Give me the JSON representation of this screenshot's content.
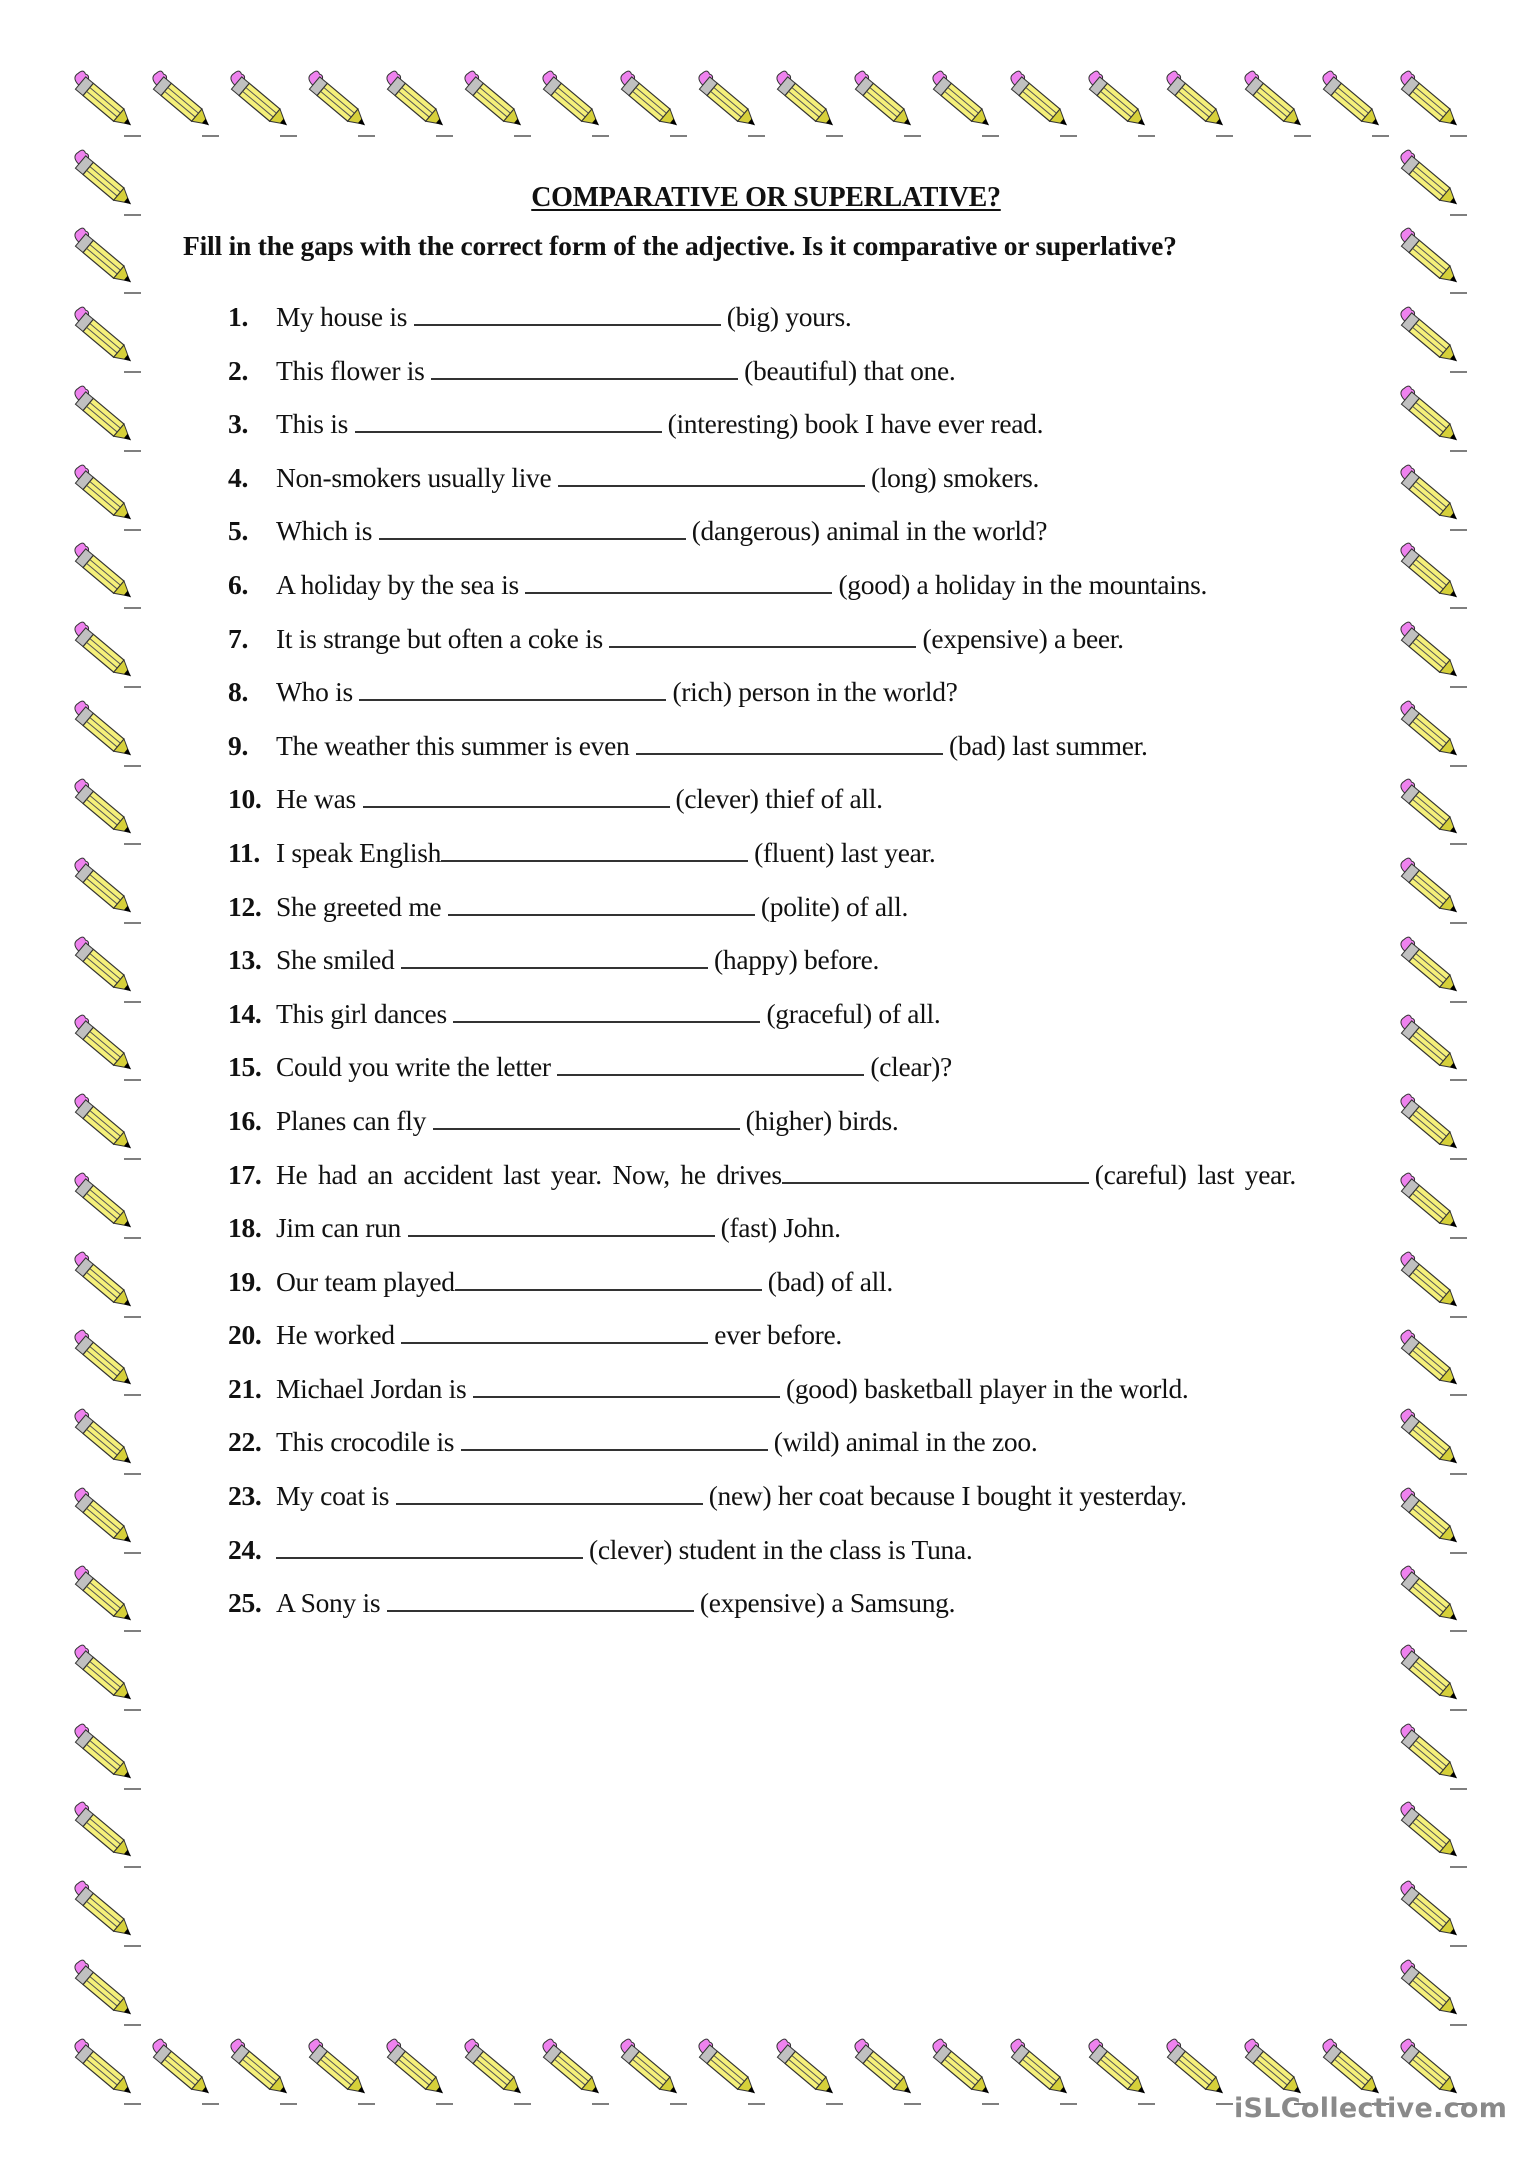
{
  "worksheet": {
    "title": "COMPARATIVE OR SUPERLATIVE?",
    "instruction": "Fill in the gaps with the correct form of the adjective. Is it comparative or superlative?",
    "items": [
      {
        "number": "1.",
        "before": "My house is",
        "after": "(big) yours."
      },
      {
        "number": "2.",
        "before": "This flower is",
        "after": "(beautiful) that one."
      },
      {
        "number": "3.",
        "before": "This is",
        "after": "(interesting) book I have ever read."
      },
      {
        "number": "4.",
        "before": "Non-smokers usually live",
        "after": "(long) smokers."
      },
      {
        "number": "5.",
        "before": "Which is",
        "after": "(dangerous) animal in the world?"
      },
      {
        "number": "6.",
        "before": "A holiday by the sea is",
        "after": "(good) a holiday in the mountains."
      },
      {
        "number": "7.",
        "before": "It is strange but often a coke is",
        "after": "(expensive) a beer."
      },
      {
        "number": "8.",
        "before": "Who is",
        "after": "(rich) person in the world?"
      },
      {
        "number": "9.",
        "before": "The weather this summer is even",
        "after": "(bad) last summer."
      },
      {
        "number": "10.",
        "before": "He was",
        "after": "(clever) thief of all."
      },
      {
        "number": "11.",
        "before": "I speak English",
        "after": "(fluent) last year."
      },
      {
        "number": "12.",
        "before": "She greeted me",
        "after": "(polite) of all."
      },
      {
        "number": "13.",
        "before": "She smiled",
        "after": "(happy) before."
      },
      {
        "number": "14.",
        "before": "This girl dances",
        "after": "(graceful) of all."
      },
      {
        "number": "15.",
        "before": "Could you write the letter",
        "after": "(clear)?"
      },
      {
        "number": "16.",
        "before": "Planes can fly",
        "after": "(higher) birds."
      },
      {
        "number": "17.",
        "before": "He had an accident last year. Now, he drives",
        "after": "(careful) last year."
      },
      {
        "number": "18.",
        "before": "Jim can run",
        "after": "(fast) John."
      },
      {
        "number": "19.",
        "before": "Our team played",
        "after": "(bad) of all."
      },
      {
        "number": "20.",
        "before": "He worked",
        "after": "ever before."
      },
      {
        "number": "21.",
        "before": "Michael Jordan is",
        "after": "(good) basketball player in the world."
      },
      {
        "number": "22.",
        "before": "This crocodile is",
        "after": "(wild) animal in the zoo."
      },
      {
        "number": "23.",
        "before": "My coat is",
        "after": "(new) her coat because I bought it yesterday."
      },
      {
        "number": "24.",
        "before": "",
        "after": "(clever) student in the class is Tuna."
      },
      {
        "number": "25.",
        "before": "A Sony is",
        "after": "(expensive) a Samsung."
      }
    ]
  },
  "border": {
    "icon": "pencil-icon",
    "colors": {
      "body": "#f5f07a",
      "eraser": "#ee82ee",
      "ferrule": "#c0c0c0",
      "tip": "#d6d03a",
      "lead": "#000000"
    }
  },
  "watermark": "iSLCollective.com"
}
